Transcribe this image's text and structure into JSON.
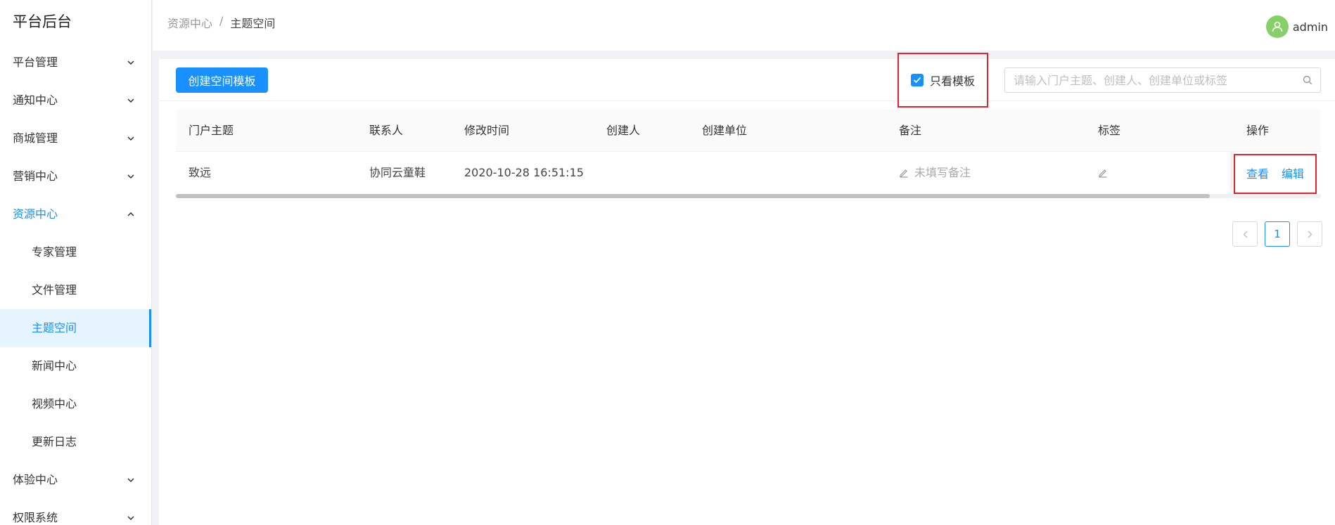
{
  "sidebar": {
    "brand": "平台后台",
    "menu": {
      "platform": "平台管理",
      "notice": "通知中心",
      "mall": "商城管理",
      "marketing": "营销中心",
      "resource": "资源中心",
      "experience": "体验中心",
      "permission": "权限系统"
    },
    "sub": {
      "expert": "专家管理",
      "file": "文件管理",
      "topic_space": "主题空间",
      "news": "新闻中心",
      "video": "视频中心",
      "changelog": "更新日志"
    }
  },
  "header": {
    "breadcrumb": [
      "资源中心",
      "/",
      "主题空间"
    ],
    "username": "admin"
  },
  "toolbar": {
    "create_label": "创建空间模板",
    "template_only_label": "只看模板",
    "search_placeholder": "请输入门户主题、创建人、创建单位或标签"
  },
  "table": {
    "columns": {
      "topic": "门户主题",
      "contact": "联系人",
      "mtime": "修改时间",
      "creator": "创建人",
      "unit": "创建单位",
      "remark": "备注",
      "tag": "标签",
      "ops": "操作"
    },
    "rows": [
      {
        "topic": "致远",
        "contact": "协同云童鞋",
        "mtime": "2020-10-28 16:51:15",
        "creator": "",
        "unit": "",
        "remark": "未填写备注",
        "tag": "",
        "view": "查看",
        "edit": "编辑"
      }
    ]
  },
  "pagination": {
    "current": "1"
  },
  "colors": {
    "primary": "#1890ff",
    "highlight_box": "#e8222a",
    "avatar": "#87d068"
  }
}
